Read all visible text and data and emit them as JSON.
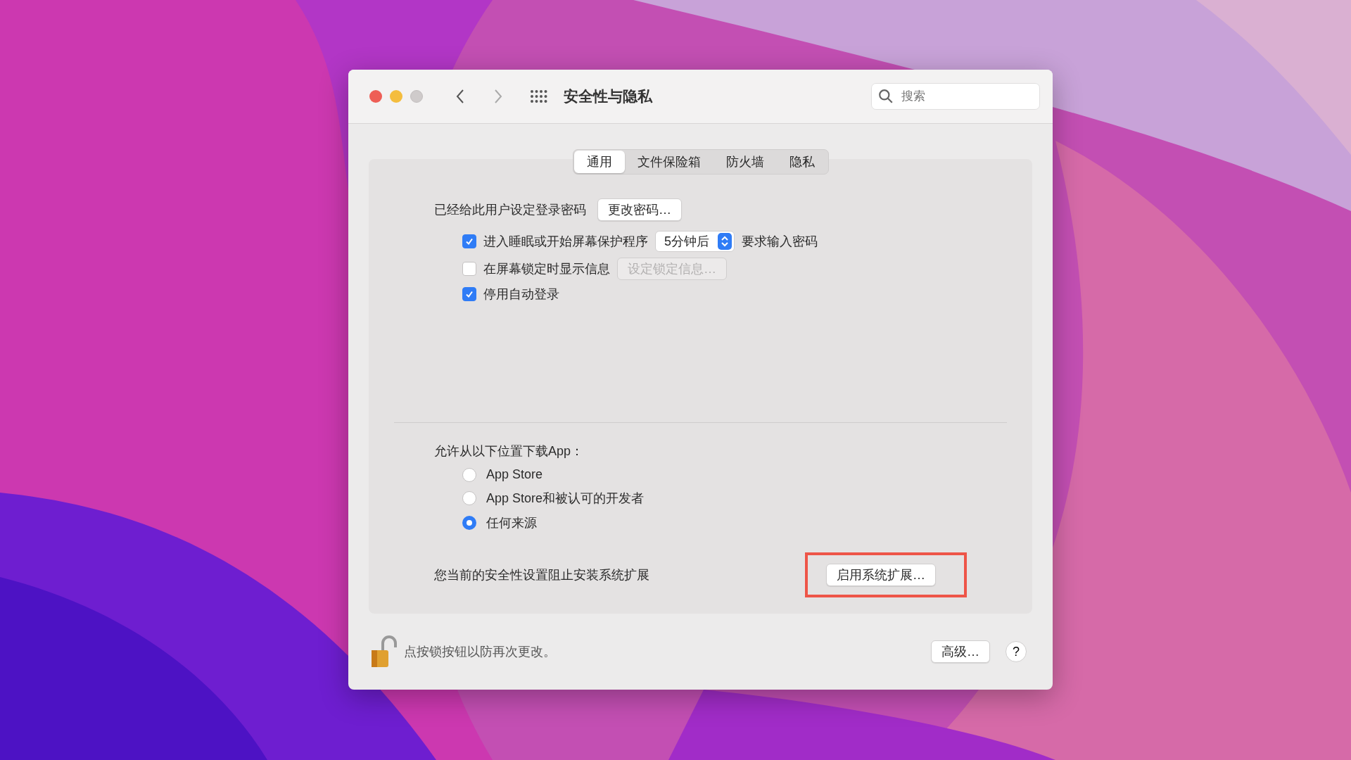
{
  "window": {
    "title": "安全性与隐私",
    "traffic_lights": [
      {
        "color": "#ee5e56",
        "disabled": false
      },
      {
        "color": "#f4bd3e",
        "disabled": false
      },
      {
        "color": "#cfcbcb",
        "disabled": true
      }
    ]
  },
  "search": {
    "placeholder": "搜索"
  },
  "tabs": [
    {
      "label": "通用",
      "selected": true
    },
    {
      "label": "文件保险箱",
      "selected": false
    },
    {
      "label": "防火墙",
      "selected": false
    },
    {
      "label": "隐私",
      "selected": false
    }
  ],
  "password": {
    "label": "已经给此用户设定登录密码",
    "button": "更改密码…"
  },
  "options": [
    {
      "kind": "delay",
      "label": "进入睡眠或开始屏幕保护程序",
      "checked": true,
      "select": "5分钟后",
      "suffix": "要求输入密码"
    },
    {
      "kind": "message",
      "label": "在屏幕锁定时显示信息",
      "checked": false,
      "button": "设定锁定信息…",
      "button_disabled": true
    },
    {
      "kind": "plain",
      "label": "停用自动登录",
      "checked": true
    }
  ],
  "downloads": {
    "title": "允许从以下位置下载App：",
    "options": [
      {
        "label": "App Store",
        "selected": false
      },
      {
        "label": "App Store和被认可的开发者",
        "selected": false
      },
      {
        "label": "任何来源",
        "selected": true
      }
    ]
  },
  "extension": {
    "text": "您当前的安全性设置阻止安装系统扩展",
    "button": "启用系统扩展…",
    "highlighted": true
  },
  "footer": {
    "lock_text": "点按锁按钮以防再次更改。",
    "locked": false,
    "advanced": "高级…",
    "help": "?"
  }
}
